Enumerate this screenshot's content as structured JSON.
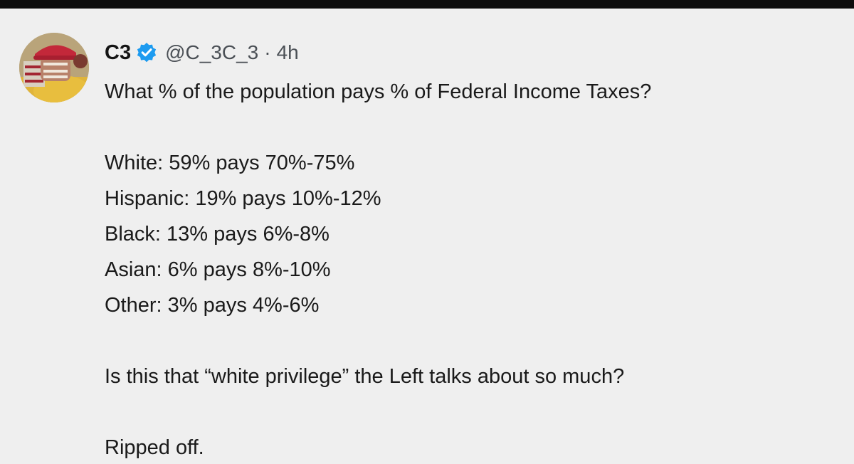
{
  "post": {
    "author": {
      "display_name": "C3",
      "handle": "@C_3C_3",
      "verified": true
    },
    "separator": "·",
    "timestamp": "4h",
    "question": "What % of the population pays % of Federal Income Taxes?",
    "lines": [
      "White: 59% pays 70%-75%",
      "Hispanic: 19% pays 10%-12%",
      "Black: 13% pays 6%-8%",
      "Asian: 6% pays 8%-10%",
      "Other: 3% pays 4%-6%"
    ],
    "closing_question": "Is this that “white privilege” the Left talks about so much?",
    "closing_remark": "Ripped off."
  },
  "colors": {
    "background": "#efefef",
    "top_bar": "#0c0c0c",
    "verified_badge": "#1d9bf0",
    "text": "#1a1a1a",
    "secondary_text": "#4a4f55"
  },
  "icons": {
    "verified": "verified-badge-icon"
  }
}
